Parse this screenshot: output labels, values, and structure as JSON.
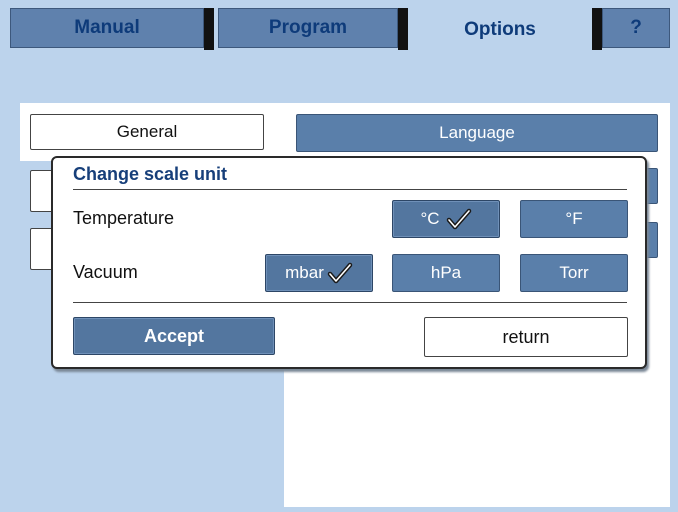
{
  "tabs": [
    {
      "label": "Manual",
      "active": false
    },
    {
      "label": "Program",
      "active": false
    },
    {
      "label": "Options",
      "active": true
    },
    {
      "label": "?",
      "active": false
    }
  ],
  "options_panel": {
    "general_label": "General",
    "language_label": "Language"
  },
  "dialog": {
    "title": "Change scale unit",
    "temperature": {
      "label": "Temperature",
      "units": [
        {
          "label": "°C",
          "selected": true
        },
        {
          "label": "°F",
          "selected": false
        }
      ]
    },
    "vacuum": {
      "label": "Vacuum",
      "units": [
        {
          "label": "mbar",
          "selected": true
        },
        {
          "label": "hPa",
          "selected": false
        },
        {
          "label": "Torr",
          "selected": false
        }
      ]
    },
    "accept_label": "Accept",
    "return_label": "return"
  },
  "colors": {
    "background": "#bcd3ec",
    "button_blue": "#5a7faa",
    "title_blue": "#173f7a"
  },
  "icons": [
    "checkmark-icon"
  ]
}
